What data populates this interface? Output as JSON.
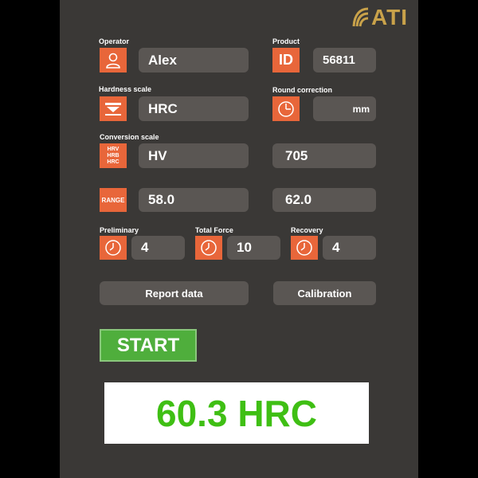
{
  "logo": {
    "text": "ATI",
    "icon": "swoosh-logo",
    "color": "#c9a24a"
  },
  "operator": {
    "label": "Operator",
    "value": "Alex",
    "icon": "user-icon"
  },
  "product": {
    "label": "Product",
    "icon_text": "ID",
    "value": "56811"
  },
  "hardness_scale": {
    "label": "Hardness scale",
    "value": "HRC",
    "icon": "indenter-icon"
  },
  "round_correction": {
    "label": "Round correction",
    "unit": "mm",
    "icon": "dial-icon"
  },
  "conversion_scale": {
    "label": "Conversion scale",
    "icon_lines": [
      "HRV",
      "HRB",
      "HRC"
    ],
    "value": "HV",
    "converted": "705"
  },
  "range": {
    "icon_text": "RANGE",
    "min": "58.0",
    "max": "62.0"
  },
  "timers": [
    {
      "label": "Preliminary",
      "value": "4",
      "icon": "clock-icon"
    },
    {
      "label": "Total Force",
      "value": "10",
      "icon": "clock-icon"
    },
    {
      "label": "Recovery",
      "value": "4",
      "icon": "clock-icon"
    }
  ],
  "buttons": {
    "report": "Report data",
    "calibration": "Calibration",
    "start": "START"
  },
  "result": {
    "text": "60.3 HRC",
    "color": "#3fbf14"
  },
  "colors": {
    "accent": "#e8663a",
    "start": "#4fae3c",
    "panel": "#3a3836",
    "field": "#5a5653"
  }
}
